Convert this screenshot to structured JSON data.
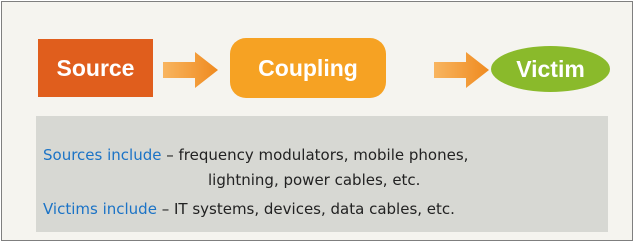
{
  "flow": {
    "source_label": "Source",
    "coupling_label": "Coupling",
    "victim_label": "Victim"
  },
  "info": {
    "sources_heading": "Sources include",
    "sources_text_line1": " – frequency modulators, mobile phones,",
    "sources_text_line2": "lightning, power cables, etc.",
    "victims_heading": "Victims include",
    "victims_text": " – IT systems, devices, data cables, etc."
  },
  "colors": {
    "source": "#e05e1d",
    "coupling": "#f6a223",
    "victim": "#8aba2b",
    "arrow": "#f39a2c",
    "heading": "#1b73c6",
    "panel": "#d7d8d3",
    "background": "#f5f4ef"
  }
}
